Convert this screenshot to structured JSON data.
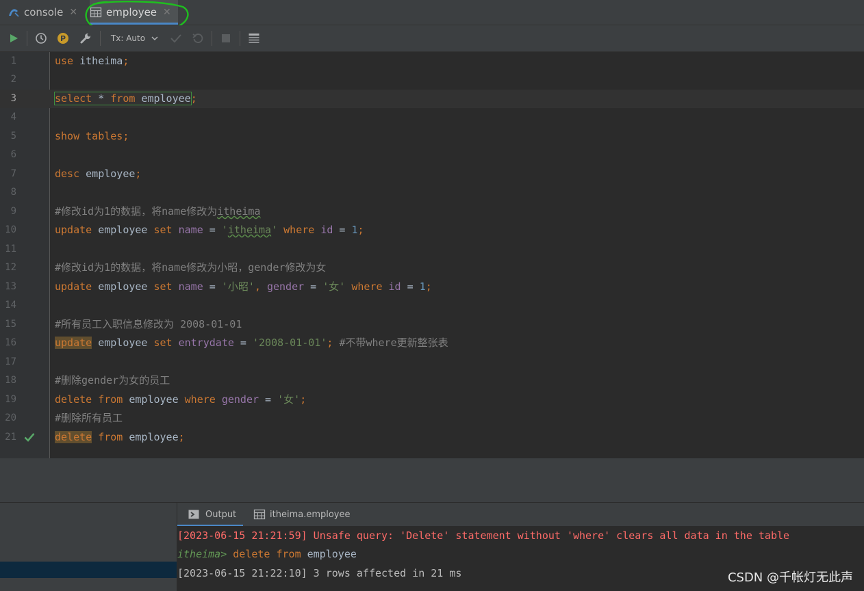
{
  "tabs": [
    {
      "label": "console",
      "icon": "mysql-console-icon"
    },
    {
      "label": "employee",
      "icon": "table-icon",
      "active": true
    }
  ],
  "toolbar": {
    "tx_label": "Tx: Auto",
    "buttons": [
      "run-icon",
      "history-icon",
      "parameters-icon",
      "settings-wrench-icon",
      "commit-check-icon",
      "rollback-icon",
      "stop-icon",
      "results-layout-icon"
    ]
  },
  "editor": {
    "current_line": 3,
    "lines": [
      {
        "n": "1"
      },
      {
        "n": "2"
      },
      {
        "n": "3"
      },
      {
        "n": "4"
      },
      {
        "n": "5"
      },
      {
        "n": "6"
      },
      {
        "n": "7"
      },
      {
        "n": "8"
      },
      {
        "n": "9"
      },
      {
        "n": "10"
      },
      {
        "n": "11"
      },
      {
        "n": "12"
      },
      {
        "n": "13"
      },
      {
        "n": "14"
      },
      {
        "n": "15"
      },
      {
        "n": "16"
      },
      {
        "n": "17"
      },
      {
        "n": "18"
      },
      {
        "n": "19"
      },
      {
        "n": "20"
      },
      {
        "n": "21"
      }
    ],
    "tokens": {
      "l1": [
        "use",
        " itheima",
        ";"
      ],
      "l3": [
        "select",
        " * ",
        "from",
        " employee",
        ";"
      ],
      "l5": [
        "show tables;"
      ],
      "l7": [
        "desc",
        " employee",
        ";"
      ],
      "l9": [
        "#修改id为1的数据，将name修改为",
        "itheima"
      ],
      "l10": [
        "update",
        " employee ",
        "set",
        " ",
        "name",
        " = ",
        "'",
        "itheima",
        "'",
        " ",
        "where",
        " ",
        "id",
        " = ",
        "1",
        ";"
      ],
      "l12": [
        "#修改id为1的数据，将name修改为小昭，gender修改为女"
      ],
      "l13": [
        "update",
        " employee ",
        "set",
        " ",
        "name",
        " = ",
        "'小昭'",
        ", ",
        "gender",
        " = ",
        "'女'",
        " ",
        "where",
        " ",
        "id",
        " = ",
        "1",
        ";"
      ],
      "l15": [
        "#所有员工入职信息修改为 2008-01-01"
      ],
      "l16": [
        "update",
        " employee ",
        "set",
        " ",
        "entrydate",
        " = ",
        "'2008-01-01'",
        "; ",
        "#不带where更新整张表"
      ],
      "l18": [
        "#删除gender为女的员工"
      ],
      "l19": [
        "delete",
        " ",
        "from",
        " employee ",
        "where",
        " ",
        "gender",
        " = ",
        "'女'",
        ";"
      ],
      "l20": [
        "#删除所有员工"
      ],
      "l21": [
        "delete",
        " ",
        "from",
        " employee",
        ";"
      ]
    }
  },
  "output": {
    "tabs": [
      {
        "label": "Output",
        "icon": "output-console-icon"
      },
      {
        "label": "itheima.employee",
        "icon": "table-icon"
      }
    ],
    "lines": {
      "warn": "[2023-06-15 21:21:59] Unsafe query: 'Delete' statement without 'where' clears all data in the table",
      "prompt": "itheima>",
      "cmd_kw1": "delete",
      "cmd_kw2": "from",
      "cmd_rest": " employee",
      "result": "[2023-06-15 21:22:10] 3 rows affected in 21 ms"
    }
  },
  "watermark": "CSDN @千帐灯无此声",
  "colors": {
    "keyword": "#cc7832",
    "string": "#6a8759",
    "number": "#6897bb",
    "comment": "#808080",
    "column": "#9876aa",
    "error": "#ff6b68",
    "annotation": "#1fbf1f"
  }
}
